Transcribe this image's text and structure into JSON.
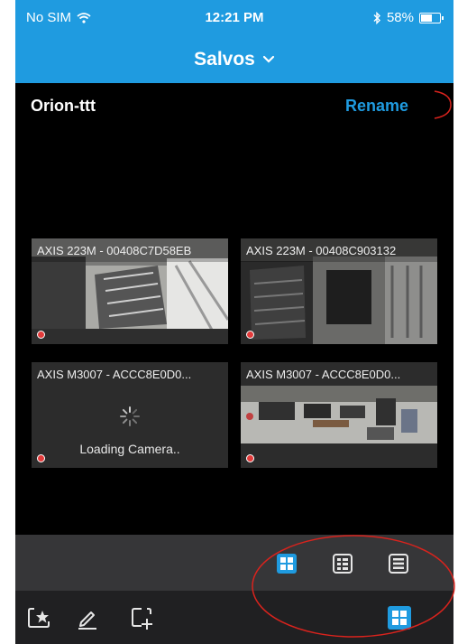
{
  "status_bar": {
    "carrier": "No SIM",
    "time": "12:21 PM",
    "battery": "58%",
    "battery_level": 0.58,
    "bluetooth_icon": "bluetooth-icon",
    "wifi_icon": "wifi-icon"
  },
  "nav": {
    "title": "Salvos",
    "dropdown_icon": "chevron-down-icon"
  },
  "view": {
    "name": "Orion-ttt",
    "rename_label": "Rename"
  },
  "cameras": [
    {
      "label": "AXIS 223M - 00408C7D58EB",
      "status": "live"
    },
    {
      "label": "AXIS 223M - 00408C903132",
      "status": "live"
    },
    {
      "label": "AXIS M3007 - ACCC8E0D0...",
      "status": "loading",
      "loading_text": "Loading Camera.."
    },
    {
      "label": "AXIS M3007 - ACCC8E0D0...",
      "status": "live"
    }
  ],
  "layout_toolbar": {
    "options": [
      "grid-2x2-icon",
      "grid-list-icon",
      "list-icon"
    ],
    "selected": "grid-2x2-icon"
  },
  "bottom_toolbar": {
    "tools": [
      "favorite-view-icon",
      "edit-icon",
      "add-view-icon"
    ],
    "view_mode": "grid-2x2-icon"
  },
  "colors": {
    "accent": "#1f9be0",
    "background": "#000000",
    "toolbar": "#363638",
    "bottom_toolbar": "#202022",
    "recording": "#e33b3b",
    "annotation": "#d9231d"
  }
}
